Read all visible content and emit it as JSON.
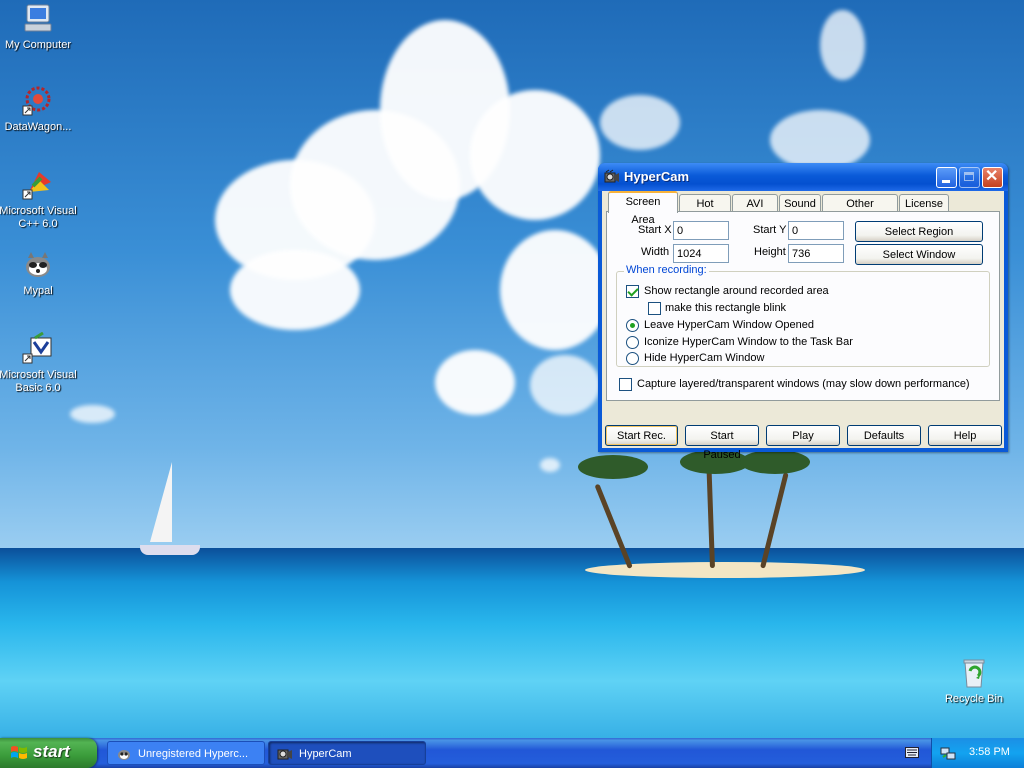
{
  "desktop": {
    "icons": [
      {
        "label": "My Computer",
        "icon": "my-computer-icon"
      },
      {
        "label": "DataWagon...",
        "icon": "datawagon-icon"
      },
      {
        "label": "Microsoft Visual C++ 6.0",
        "icon": "visual-cpp-icon"
      },
      {
        "label": "Mypal",
        "icon": "mypal-icon"
      },
      {
        "label": "Microsoft Visual Basic 6.0",
        "icon": "visual-basic-icon"
      },
      {
        "label": "Recycle Bin",
        "icon": "recycle-bin-icon"
      }
    ]
  },
  "window": {
    "title": "HyperCam",
    "tabs": [
      "Screen Area",
      "Hot Keys",
      "AVI File",
      "Sound",
      "Other Options",
      "License"
    ],
    "active_tab": "Screen Area",
    "fields": {
      "start_x_label": "Start X",
      "start_x_value": "0",
      "start_y_label": "Start Y",
      "start_y_value": "0",
      "width_label": "Width",
      "width_value": "1024",
      "height_label": "Height",
      "height_value": "736"
    },
    "select_region_label": "Select Region",
    "select_window_label": "Select Window",
    "group_title": "When recording:",
    "options": {
      "show_rectangle": {
        "label": "Show rectangle around recorded area",
        "checked": true
      },
      "blink": {
        "label": "make this rectangle blink",
        "checked": false
      },
      "leave_opened": {
        "label": "Leave HyperCam Window Opened",
        "selected": true
      },
      "iconize": {
        "label": "Iconize HyperCam Window to the Task Bar",
        "selected": false
      },
      "hide": {
        "label": "Hide HyperCam Window",
        "selected": false
      }
    },
    "capture_layered": {
      "label": "Capture layered/transparent windows (may slow down performance)",
      "checked": false
    },
    "buttons": {
      "start_rec": "Start Rec.",
      "start_paused": "Start Paused",
      "play": "Play",
      "defaults": "Defaults",
      "help": "Help"
    }
  },
  "taskbar": {
    "start_label": "start",
    "tasks": [
      {
        "label": "Unregistered Hyperc...",
        "icon": "mypal-icon",
        "active": false
      },
      {
        "label": "HyperCam",
        "icon": "hypercam-icon",
        "active": true
      }
    ],
    "clock": "3:58 PM"
  },
  "colors": {
    "title_bar": "#0a5ad8",
    "start_button": "#3a9b3a",
    "taskbar": "#245edb",
    "tray": "#13a3f0"
  }
}
